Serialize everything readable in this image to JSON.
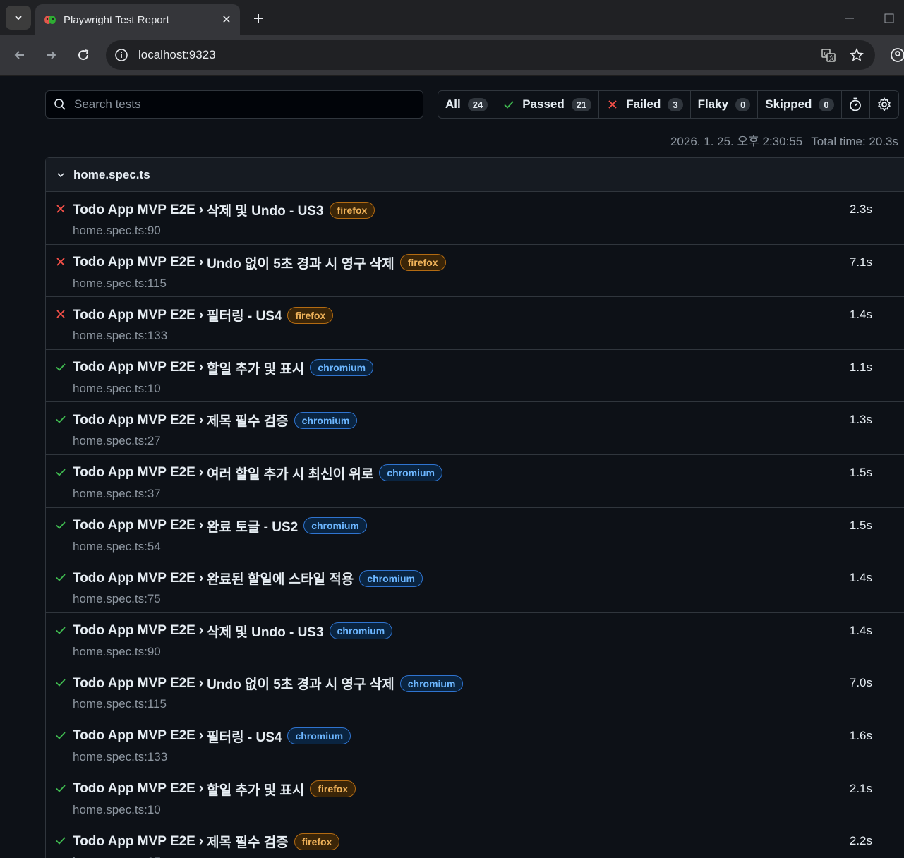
{
  "browser": {
    "tab_title": "Playwright Test Report",
    "url": "localhost:9323",
    "icons": {
      "tab_menu": "chevron-down-icon",
      "favicon": "playwright-icon",
      "close": "close-icon",
      "new_tab": "plus-icon",
      "back": "arrow-left-icon",
      "forward": "arrow-right-icon",
      "reload": "reload-icon",
      "site_info": "info-icon",
      "translate": "translate-icon",
      "bookmark": "star-icon",
      "profile": "profile-icon"
    }
  },
  "search": {
    "placeholder": "Search tests",
    "value": ""
  },
  "filters": [
    {
      "label": "All",
      "count": "24",
      "icon": ""
    },
    {
      "label": "Passed",
      "count": "21",
      "icon": "check-icon"
    },
    {
      "label": "Failed",
      "count": "3",
      "icon": "x-icon"
    },
    {
      "label": "Flaky",
      "count": "0",
      "icon": ""
    },
    {
      "label": "Skipped",
      "count": "0",
      "icon": ""
    }
  ],
  "meta": {
    "timestamp": "2026. 1. 25. 오후 2:30:55",
    "total_time": "Total time: 20.3s"
  },
  "file": {
    "name": "home.spec.ts",
    "tests": [
      {
        "status": "failed",
        "path": "Todo App MVP E2E",
        "name": "삭제 및 Undo - US3",
        "project": "firefox",
        "location": "home.spec.ts:90",
        "duration": "2.3s"
      },
      {
        "status": "failed",
        "path": "Todo App MVP E2E",
        "name": "Undo 없이 5초 경과 시 영구 삭제",
        "project": "firefox",
        "location": "home.spec.ts:115",
        "duration": "7.1s"
      },
      {
        "status": "failed",
        "path": "Todo App MVP E2E",
        "name": "필터링 - US4",
        "project": "firefox",
        "location": "home.spec.ts:133",
        "duration": "1.4s"
      },
      {
        "status": "passed",
        "path": "Todo App MVP E2E",
        "name": "할일 추가 및 표시",
        "project": "chromium",
        "location": "home.spec.ts:10",
        "duration": "1.1s"
      },
      {
        "status": "passed",
        "path": "Todo App MVP E2E",
        "name": "제목 필수 검증",
        "project": "chromium",
        "location": "home.spec.ts:27",
        "duration": "1.3s"
      },
      {
        "status": "passed",
        "path": "Todo App MVP E2E",
        "name": "여러 할일 추가 시 최신이 위로",
        "project": "chromium",
        "location": "home.spec.ts:37",
        "duration": "1.5s"
      },
      {
        "status": "passed",
        "path": "Todo App MVP E2E",
        "name": "완료 토글 - US2",
        "project": "chromium",
        "location": "home.spec.ts:54",
        "duration": "1.5s"
      },
      {
        "status": "passed",
        "path": "Todo App MVP E2E",
        "name": "완료된 할일에 스타일 적용",
        "project": "chromium",
        "location": "home.spec.ts:75",
        "duration": "1.4s"
      },
      {
        "status": "passed",
        "path": "Todo App MVP E2E",
        "name": "삭제 및 Undo - US3",
        "project": "chromium",
        "location": "home.spec.ts:90",
        "duration": "1.4s"
      },
      {
        "status": "passed",
        "path": "Todo App MVP E2E",
        "name": "Undo 없이 5초 경과 시 영구 삭제",
        "project": "chromium",
        "location": "home.spec.ts:115",
        "duration": "7.0s"
      },
      {
        "status": "passed",
        "path": "Todo App MVP E2E",
        "name": "필터링 - US4",
        "project": "chromium",
        "location": "home.spec.ts:133",
        "duration": "1.6s"
      },
      {
        "status": "passed",
        "path": "Todo App MVP E2E",
        "name": "할일 추가 및 표시",
        "project": "firefox",
        "location": "home.spec.ts:10",
        "duration": "2.1s"
      },
      {
        "status": "passed",
        "path": "Todo App MVP E2E",
        "name": "제목 필수 검증",
        "project": "firefox",
        "location": "home.spec.ts:27",
        "duration": "2.2s"
      }
    ]
  },
  "colors": {
    "passed": "#3fb950",
    "failed": "#f85149",
    "firefox_badge": "#f0b35a",
    "chromium_badge": "#6cb6ff"
  }
}
